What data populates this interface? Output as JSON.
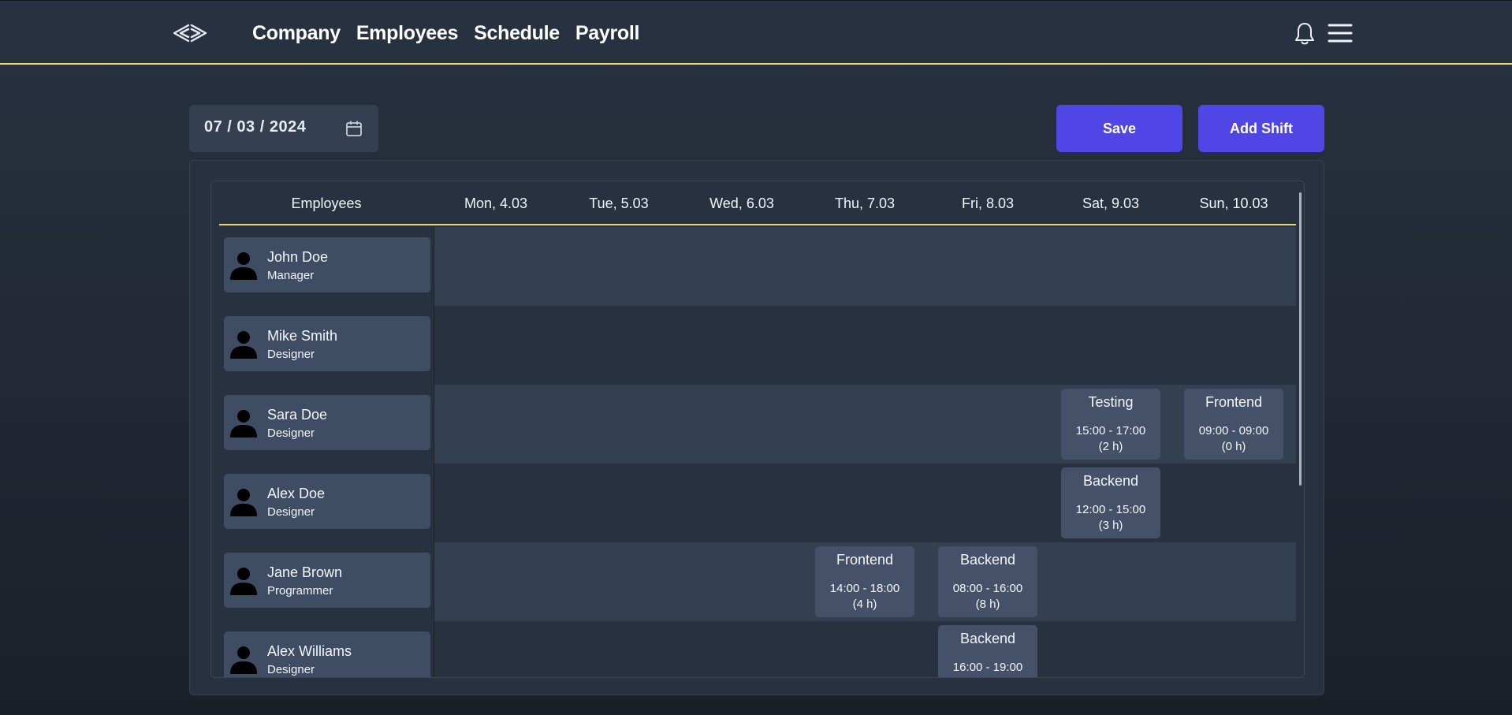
{
  "nav": {
    "items": [
      {
        "label": "Company"
      },
      {
        "label": "Employees"
      },
      {
        "label": "Schedule"
      },
      {
        "label": "Payroll"
      }
    ],
    "logo_icon": "brand-chevrons-icon",
    "bell_icon": "bell-icon",
    "menu_icon": "hamburger-menu-icon"
  },
  "toolbar": {
    "date_value": "07 / 03 / 2024",
    "calendar_icon": "calendar-icon",
    "save_label": "Save",
    "add_shift_label": "Add Shift"
  },
  "colors": {
    "accent": "#4f46e5",
    "header_underline": "#e9d773",
    "card": "#3e4d63",
    "shift_card": "#445168"
  },
  "schedule": {
    "employees_header": "Employees",
    "days": [
      "Mon, 4.03",
      "Tue, 5.03",
      "Wed, 6.03",
      "Thu, 7.03",
      "Fri, 8.03",
      "Sat, 9.03",
      "Sun, 10.03"
    ],
    "employees": [
      {
        "name": "John Doe",
        "role": "Manager",
        "shifts": []
      },
      {
        "name": "Mike Smith",
        "role": "Designer",
        "shifts": []
      },
      {
        "name": "Sara Doe",
        "role": "Designer",
        "shifts": [
          {
            "day": "Sat, 9.03",
            "title": "Testing",
            "time": "15:00 - 17:00",
            "duration": "(2 h)"
          },
          {
            "day": "Sun, 10.03",
            "title": "Frontend",
            "time": "09:00 - 09:00",
            "duration": "(0 h)"
          }
        ]
      },
      {
        "name": "Alex Doe",
        "role": "Designer",
        "shifts": [
          {
            "day": "Sat, 9.03",
            "title": "Backend",
            "time": "12:00 - 15:00",
            "duration": "(3 h)"
          }
        ]
      },
      {
        "name": "Jane Brown",
        "role": "Programmer",
        "shifts": [
          {
            "day": "Thu, 7.03",
            "title": "Frontend",
            "time": "14:00 - 18:00",
            "duration": "(4 h)"
          },
          {
            "day": "Fri, 8.03",
            "title": "Backend",
            "time": "08:00 - 16:00",
            "duration": "(8 h)"
          }
        ]
      },
      {
        "name": "Alex Williams",
        "role": "Designer",
        "shifts": [
          {
            "day": "Fri, 8.03",
            "title": "Backend",
            "time": "16:00 - 19:00",
            "duration": ""
          }
        ]
      }
    ]
  }
}
